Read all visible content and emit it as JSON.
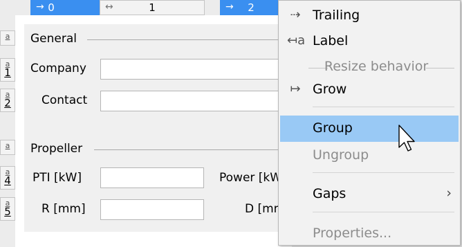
{
  "columns": [
    {
      "icon": "→",
      "label": "0",
      "selected": true
    },
    {
      "icon": "↔",
      "label": "1",
      "selected": false
    },
    {
      "icon": "→",
      "label": "2",
      "selected": true
    }
  ],
  "rows": [
    {
      "icon": "a",
      "label": ""
    },
    {
      "icon": "a",
      "label": "1"
    },
    {
      "icon": "a",
      "label": "2"
    },
    {
      "icon": "a",
      "label": ""
    },
    {
      "icon": "a",
      "label": "4"
    },
    {
      "icon": "a",
      "label": "5"
    }
  ],
  "form": {
    "general_title": "General",
    "company_label": "Company",
    "contact_label": "Contact",
    "propeller_title": "Propeller",
    "pti_label": "PTI [kW]",
    "power_label": "Power [kW]",
    "r_label": "R [mm]",
    "d_label": "D [mm]"
  },
  "menu": {
    "trailing": "Trailing",
    "label": "Label",
    "resize_header": "Resize behavior",
    "grow": "Grow",
    "group": "Group",
    "ungroup": "Ungroup",
    "gaps": "Gaps",
    "properties": "Properties...",
    "icons": {
      "trailing": "⇢",
      "label": "↤a",
      "grow": "↦",
      "submenu": "›"
    }
  },
  "colors": {
    "selected_header": "#3a8ff0",
    "menu_hover": "#99c9f5"
  }
}
